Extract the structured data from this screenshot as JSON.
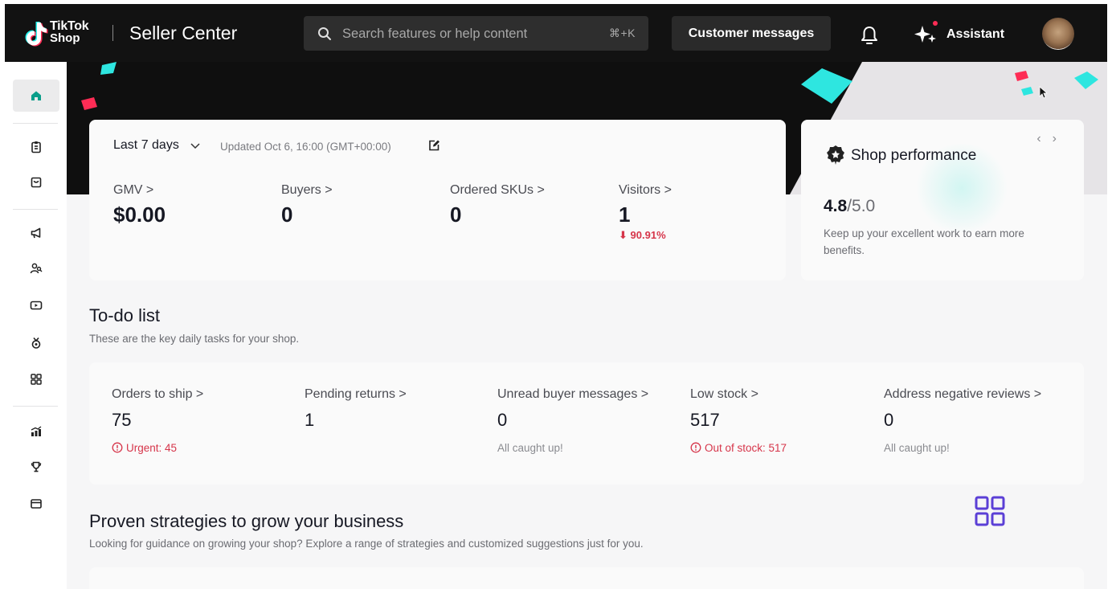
{
  "header": {
    "brand_line1": "TikTok",
    "brand_line2": "Shop",
    "app_title": "Seller Center",
    "search_placeholder": "Search features or help content",
    "search_shortcut": "⌘+K",
    "customer_messages_label": "Customer messages",
    "assistant_label": "Assistant",
    "notification_dot_color": "#fe2c55"
  },
  "sidebar": {
    "items": [
      {
        "icon": "home-icon",
        "active": true
      },
      {
        "icon": "orders-icon"
      },
      {
        "icon": "products-icon"
      },
      {
        "icon": "marketing-icon"
      },
      {
        "icon": "creators-icon"
      },
      {
        "icon": "live-video-icon"
      },
      {
        "icon": "rewards-icon"
      },
      {
        "icon": "apps-icon"
      },
      {
        "icon": "analytics-icon"
      },
      {
        "icon": "trophy-icon"
      },
      {
        "icon": "finance-icon"
      }
    ]
  },
  "metrics": {
    "range_label": "Last 7 days",
    "updated_text": "Updated Oct 6, 16:00 (GMT+00:00)",
    "items": [
      {
        "label": "GMV >",
        "value": "$0.00"
      },
      {
        "label": "Buyers >",
        "value": "0"
      },
      {
        "label": "Ordered SKUs >",
        "value": "0"
      },
      {
        "label": "Visitors >",
        "value": "1",
        "change": "90.91%",
        "change_direction": "down"
      }
    ]
  },
  "shop_performance": {
    "title": "Shop performance",
    "score": "4.8",
    "max": "/5.0",
    "description": "Keep up your excellent work to earn more benefits."
  },
  "todo": {
    "title": "To-do list",
    "subtitle": "These are the key daily tasks for your shop.",
    "items": [
      {
        "label": "Orders to ship >",
        "value": "75",
        "note": "Urgent: 45",
        "urgent": true
      },
      {
        "label": "Pending returns >",
        "value": "1",
        "note": ""
      },
      {
        "label": "Unread buyer messages >",
        "value": "0",
        "note": "All caught up!"
      },
      {
        "label": "Low stock >",
        "value": "517",
        "note": "Out of stock: 517",
        "urgent": true
      },
      {
        "label": "Address negative reviews >",
        "value": "0",
        "note": "All caught up!"
      }
    ]
  },
  "strategies": {
    "title": "Proven strategies to grow your business",
    "subtitle": "Looking for guidance on growing your shop? Explore a range of strategies and customized suggestions just for you."
  },
  "colors": {
    "accent_cyan": "#2ee6e0",
    "accent_red": "#fe2c55",
    "negative_red": "#d6354a",
    "grid_icon_purple": "#5b3fd6"
  }
}
